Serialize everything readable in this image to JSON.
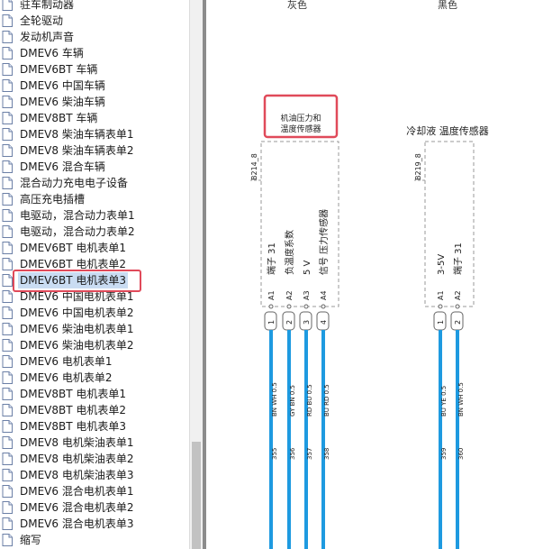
{
  "tree": {
    "items": [
      "驻车制动器",
      "全轮驱动",
      "发动机声音",
      "DMEV6 车辆",
      "DMEV6BT 车辆",
      "DMEV6 中国车辆",
      "DMEV6 柴油车辆",
      "DMEV8BT 车辆",
      "DMEV8 柴油车辆表单1",
      "DMEV8 柴油车辆表单2",
      "DMEV6 混合车辆",
      "混合动力充电电子设备",
      "高压充电插槽",
      "电驱动，混合动力表单1",
      "电驱动，混合动力表单2",
      "DMEV6BT 电机表单1",
      "DMEV6BT 电机表单2",
      "DMEV6BT 电机表单3",
      "DMEV6 中国电机表单1",
      "DMEV6 中国电机表单2",
      "DMEV6 柴油电机表单1",
      "DMEV6 柴油电机表单2",
      "DMEV6 电机表单1",
      "DMEV6 电机表单2",
      "DMEV8BT 电机表单1",
      "DMEV8BT 电机表单2",
      "DMEV8BT 电机表单3",
      "DMEV8 电机柴油表单1",
      "DMEV8 电机柴油表单2",
      "DMEV8 电机柴油表单3",
      "DMEV6 混合电机表单1",
      "DMEV6 混合电机表单2",
      "DMEV6 混合电机表单3",
      "缩写"
    ],
    "selected_index": 17
  },
  "diagram": {
    "color_gray": "灰色",
    "color_black": "黑色",
    "sensor1": {
      "title_line1": "机油压力和",
      "title_line2": "温度传感器",
      "code": "B214_8",
      "pins": [
        {
          "label": "端子 31",
          "pin": "A1",
          "num": "1",
          "wire": "BN WH 0.5",
          "circuit": "355"
        },
        {
          "label": "负温度系数",
          "pin": "A2",
          "num": "2",
          "wire": "GY BN 0.5",
          "circuit": "356"
        },
        {
          "label": "5 V",
          "pin": "A3",
          "num": "3",
          "wire": "RD BU 0.5",
          "circuit": "357"
        },
        {
          "label": "信号 压力传感器",
          "pin": "A4",
          "num": "4",
          "wire": "BU RD 0.5",
          "circuit": "358"
        }
      ]
    },
    "sensor2": {
      "title": "冷却液 温度传感器",
      "code": "B219_8",
      "pins": [
        {
          "label": "3-5V",
          "pin": "A1",
          "num": "1",
          "wire": "BU YE 0.5",
          "circuit": "359"
        },
        {
          "label": "端子 31",
          "pin": "A2",
          "num": "2",
          "wire": "BN WH 0.5",
          "circuit": "360"
        }
      ]
    },
    "colors": {
      "wire": "#1e9ae0",
      "highlight": "#e04a5a",
      "box": "#999999",
      "selection": "#c9dcf2"
    }
  }
}
